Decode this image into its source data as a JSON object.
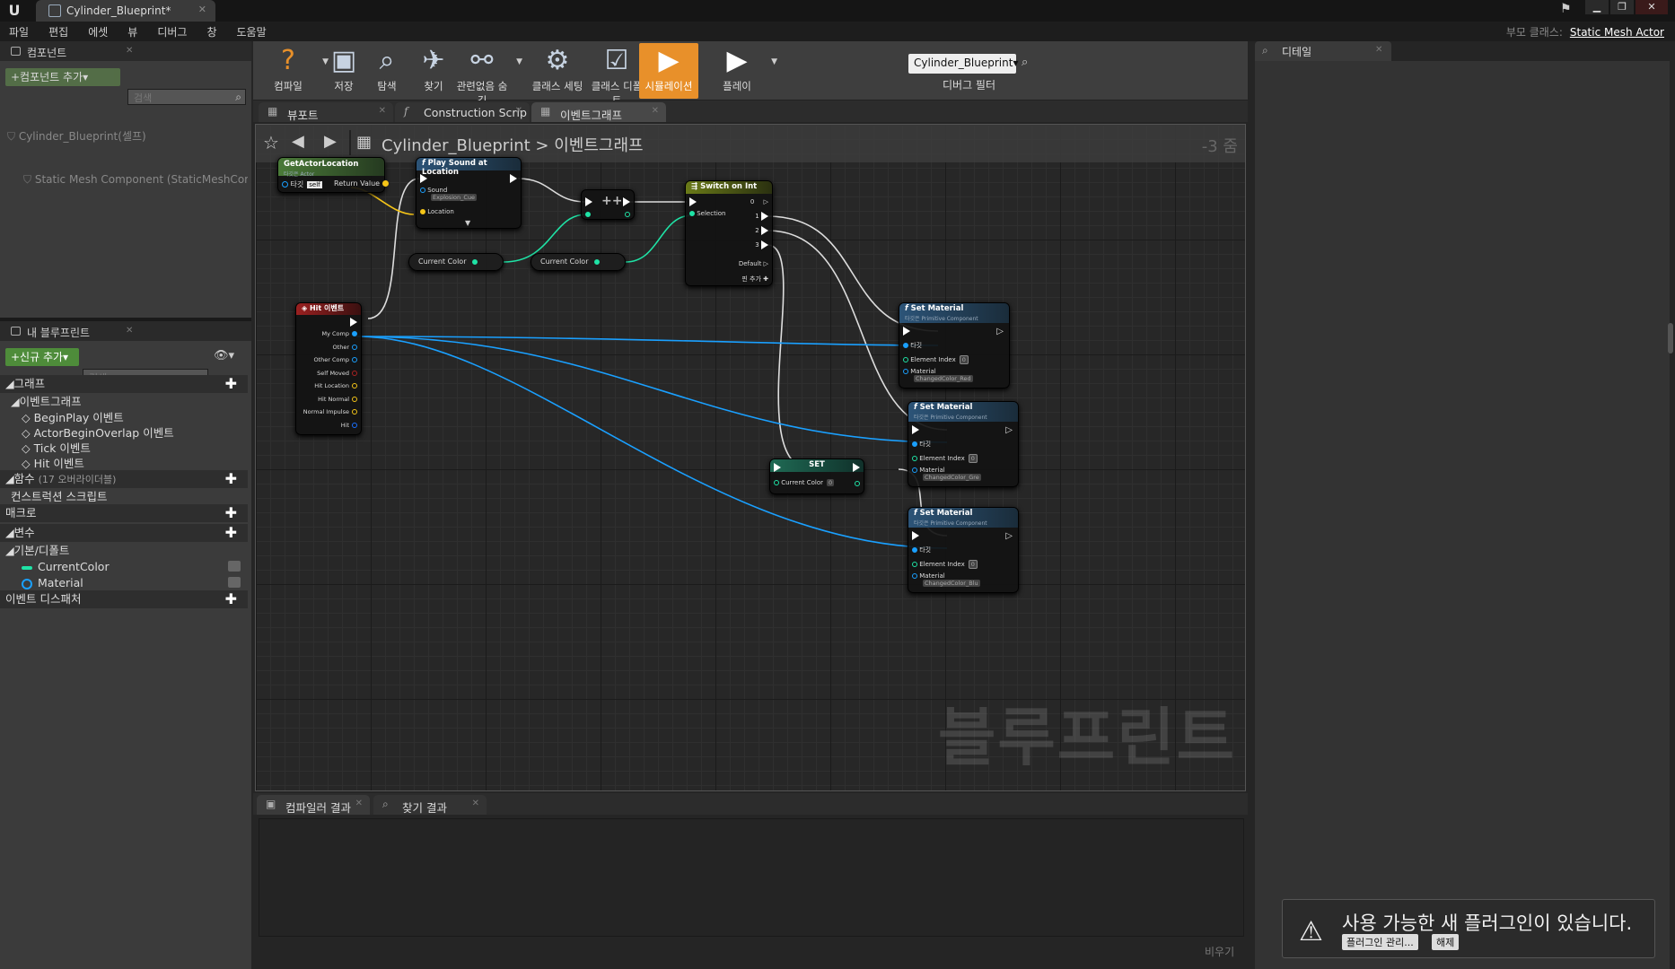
{
  "window": {
    "tab_title": "Cylinder_Blueprint*",
    "logo": "U",
    "parent_class_label": "부모 클래스:",
    "parent_class_value": "Static Mesh Actor"
  },
  "menu": [
    "파일",
    "편집",
    "에셋",
    "뷰",
    "디버그",
    "창",
    "도움말"
  ],
  "components_panel": {
    "title": "컴포넌트",
    "add_button": "+컴포넌트 추가▾",
    "search_placeholder": "검색",
    "items": [
      "Cylinder_Blueprint(셀프)",
      "Static Mesh Component (StaticMeshCompo"
    ]
  },
  "my_blueprint_panel": {
    "title": "내 블루프린트",
    "add_button": "+신규 추가▾",
    "search_placeholder": "검색",
    "rows": [
      {
        "label": "◢그래프",
        "kind": "category",
        "plus": true
      },
      {
        "label": "◢이벤트그래프",
        "kind": "item-lvl1"
      },
      {
        "label": "BeginPlay 이벤트",
        "kind": "item-lvl2"
      },
      {
        "label": "ActorBeginOverlap 이벤트",
        "kind": "item-lvl2"
      },
      {
        "label": "Tick 이벤트",
        "kind": "item-lvl2"
      },
      {
        "label": "Hit 이벤트",
        "kind": "item-lvl2"
      },
      {
        "label": "◢함수",
        "extra": "(17 오버라이더블)",
        "kind": "category",
        "plus": true
      },
      {
        "label": "컨스트럭션 스크립트",
        "kind": "item-lvl1"
      },
      {
        "label": "매크로",
        "kind": "category",
        "plus": true
      },
      {
        "label": "◢변수",
        "kind": "category",
        "plus": true
      },
      {
        "label": "◢기본/디폴트",
        "kind": "item-lvl0"
      },
      {
        "label": "CurrentColor",
        "kind": "var-int"
      },
      {
        "label": "Material",
        "kind": "var-obj"
      },
      {
        "label": "이벤트 디스패처",
        "kind": "category",
        "plus": true
      }
    ]
  },
  "toolbar": {
    "buttons": [
      {
        "label": "컴파일",
        "icon": "compile-icon",
        "glyph": "?"
      },
      {
        "label": "저장",
        "icon": "save-icon",
        "glyph": "▣"
      },
      {
        "label": "탐색",
        "icon": "browse-icon",
        "glyph": "⌕"
      },
      {
        "label": "찾기",
        "icon": "find-icon",
        "glyph": "✈"
      },
      {
        "label": "관련없음 숨김",
        "icon": "hide-unrelated-icon",
        "glyph": "⚯"
      },
      {
        "label": "클래스 세팅",
        "icon": "class-settings-icon",
        "glyph": "⚙"
      },
      {
        "label": "클래스 디폴트",
        "icon": "class-defaults-icon",
        "glyph": "☑"
      },
      {
        "label": "시뮬레이션",
        "icon": "simulation-icon",
        "glyph": "▶"
      },
      {
        "label": "플레이",
        "icon": "play-icon",
        "glyph": "▶"
      }
    ],
    "debug_selected": "Cylinder_Blueprint▾",
    "debug_label": "디버그 필터"
  },
  "graph_tabs": [
    "뷰포트",
    "Construction Scrip",
    "이벤트그래프"
  ],
  "breadcrumb": {
    "root": "Cylinder_Blueprint",
    "sep": ">",
    "current": "이벤트그래프",
    "zoom": "-3 줌"
  },
  "nodes": {
    "get_actor_location": {
      "title": "GetActorLocation",
      "sub": "타깃은 Actor",
      "pin_target": "타깃",
      "pin_self": "self",
      "pin_return": "Return Value"
    },
    "play_sound": {
      "title": "Play Sound at Location",
      "pin_sound": "Sound",
      "sound_value": "Explosion_Cue",
      "pin_location": "Location"
    },
    "increment": {
      "title": "++"
    },
    "switch_on_int": {
      "title": "Switch on Int",
      "pin_selection": "Selection",
      "outs": [
        "0",
        "1",
        "2",
        "3"
      ],
      "default": "Default",
      "add_pin": "핀 추가"
    },
    "current_color_1": "Current Color",
    "current_color_2": "Current Color",
    "hit_event": {
      "title": "Hit 이벤트",
      "pins": [
        "My Comp",
        "Other",
        "Other Comp",
        "Self Moved",
        "Hit Location",
        "Hit Normal",
        "Normal Impulse",
        "Hit"
      ]
    },
    "set_var": {
      "title": "SET",
      "pin": "Current Color",
      "value": "0"
    },
    "set_material_1": {
      "title": "Set Material",
      "sub": "타깃은 Primitive Component",
      "target": "타깃",
      "element_index": "Element Index",
      "ei_value": "0",
      "material": "Material",
      "mat_value": "ChangedColor_Red"
    },
    "set_material_2": {
      "title": "Set Material",
      "sub": "타깃은 Primitive Component",
      "target": "타깃",
      "element_index": "Element Index",
      "ei_value": "0",
      "material": "Material",
      "mat_value": "ChangedColor_Gre"
    },
    "set_material_3": {
      "title": "Set Material",
      "sub": "타깃은 Primitive Component",
      "target": "타깃",
      "element_index": "Element Index",
      "ei_value": "0",
      "material": "Material",
      "mat_value": "ChangedColor_Blu"
    }
  },
  "watermark": "블루프린트",
  "bottom_tabs": [
    "컴파일러 결과",
    "찾기 결과"
  ],
  "clear_label": "비우기",
  "details_title": "디테일",
  "notification": {
    "text": "사용 가능한 새 플러그인이 있습니다.",
    "manage": "플러그인 관리...",
    "dismiss": "해제"
  },
  "colors": {
    "exec": "#ffffff",
    "object_pin": "#1aa0ff",
    "int_pin": "#1fe3a6",
    "vector_pin": "#f5c518",
    "accent_orange": "#e8902a",
    "add_green": "#4e8c3a"
  }
}
